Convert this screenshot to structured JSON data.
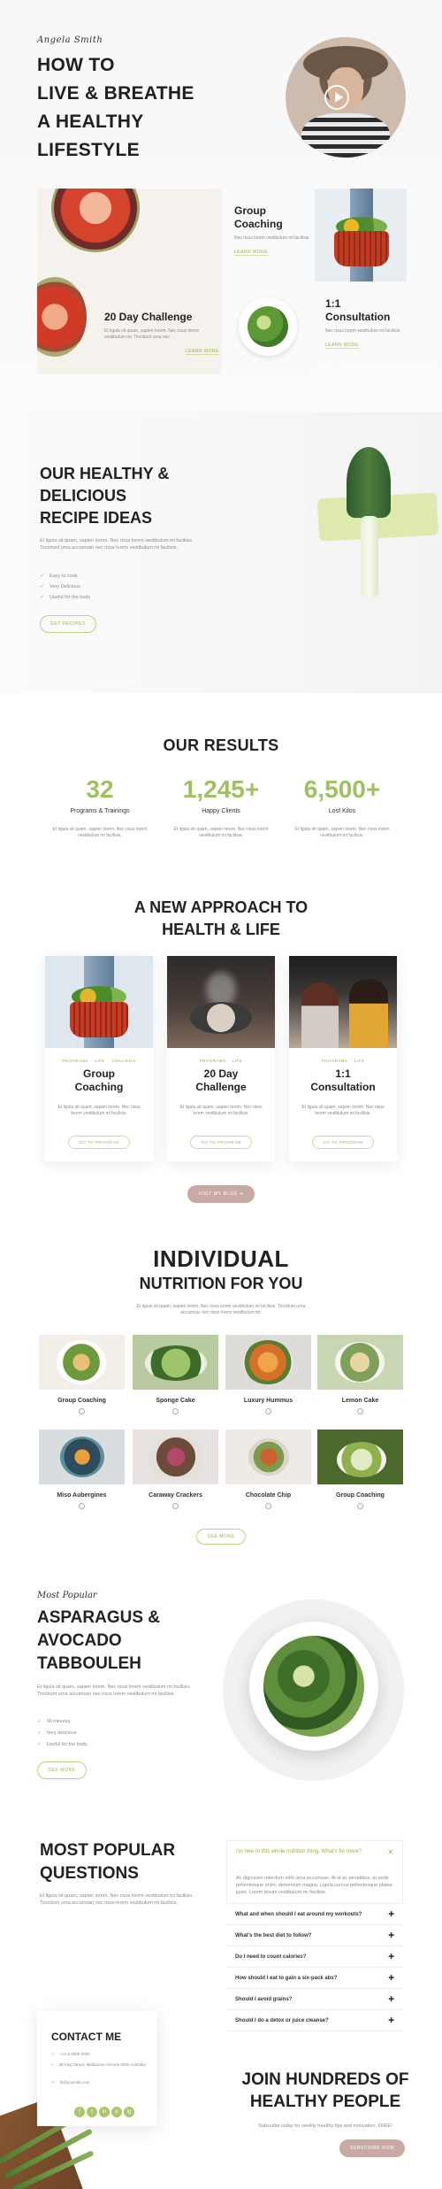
{
  "hero": {
    "signature": "Angela Smith",
    "title_lines": [
      "HOW TO",
      "LIVE & BREATHE",
      "A HEALTHY",
      "LIFESTYLE"
    ]
  },
  "services": {
    "challenge": {
      "title": "20 Day Challenge",
      "text": "Et ligula sit quam, sapien lorem. Nec risus lorem vestibulum mi. Tincidunt uma nec.",
      "link": "LEARN MORE"
    },
    "group": {
      "title_lines": [
        "Group",
        "Coaching"
      ],
      "text": "Nec risus lorem vestibulum mi facilisis.",
      "link": "LEARN MORE"
    },
    "consultation": {
      "title_lines": [
        "1:1",
        "Consultation"
      ],
      "text": "Nec risus lorem vestibulum mi facilisis.",
      "link": "LEARN MORE"
    }
  },
  "recipes": {
    "title_lines": [
      "OUR HEALTHY &",
      "DELICIOUS",
      "RECIPE IDEAS"
    ],
    "text": "Et ligula sit quam, sapien lorem. Nec risus lorem vestibulum mi facilisis. Tincidunt urna accumsan nec risus lorem vestibulum mi facilisis.",
    "list": [
      "Easy to cook",
      "Very Delicious",
      "Useful for the body"
    ],
    "button": "GET RECIPES",
    "check_icon": "check-icon"
  },
  "results": {
    "title": "OUR RESULTS",
    "stats": [
      {
        "number": "32",
        "label": "Programs & Trainings",
        "text": "Et ligula sit quam, sapien lorem. Nec risus lorem vestibulum mi facilisis."
      },
      {
        "number": "1,245+",
        "label": "Happy Clients",
        "text": "Et ligula sit quam, sapien lorem. Nec risus lorem vestibulum mi facilisis."
      },
      {
        "number": "6,500+",
        "label": "Lost Kilos",
        "text": "Et ligula sit quam, sapien lorem. Nec risus lorem vestibulum mi facilisis."
      }
    ]
  },
  "approach": {
    "title_lines": [
      "A NEW APPROACH TO",
      "HEALTH & LIFE"
    ],
    "cards": [
      {
        "tags": [
          "PROGRAMS",
          "LIFE",
          "COACHING"
        ],
        "title_lines": [
          "Group",
          "Coaching"
        ],
        "text": "Et ligula sit quam, sapien lorem. Nec risus lorem vestibulum mi facilisis.",
        "button": "GO TO PROGRAM"
      },
      {
        "tags": [
          "PROGRAMS",
          "LIFE"
        ],
        "title_lines": [
          "20 Day",
          "Challenge"
        ],
        "text": "Et ligula sit quam, sapien lorem. Nec risus lorem vestibulum mi facilisis.",
        "button": "GO TO PROGRAM"
      },
      {
        "tags": [
          "PROGRAMS",
          "LIFE"
        ],
        "title_lines": [
          "1:1",
          "Consultation"
        ],
        "text": "Et ligula sit quam, sapien lorem. Nec risus lorem vestibulum mi facilisis.",
        "button": "GO TO PROGRAM"
      }
    ],
    "visit_button": "VISIT MY BLOG ➔"
  },
  "nutrition": {
    "title1": "INDIVIDUAL",
    "title2": "NUTRITION FOR YOU",
    "text": "Et ligula sit quam, sapien lorem. Nec risus lorem vestibulum mi facilisis. Tincidunt urna accumsan nec risus lorem vestibulum mi.",
    "items": [
      "Group Coaching",
      "Sponge Cake",
      "Luxury Hummus",
      "Lemon Cake",
      "Miso Aubergines",
      "Caraway Crackers",
      "Chocolate Chip",
      "Group Coaching"
    ],
    "button": "SEE MORE"
  },
  "popular": {
    "signature": "Most Popular",
    "title_lines": [
      "ASPARAGUS &",
      "AVOCADO",
      "TABBOULEH"
    ],
    "text": "Et ligula sit quam, sapien lorem. Nec risus lorem vestibulum mi facilisis. Tincidunt urna accumsan nec risus lorem vestibulum mi facilisis.",
    "list": [
      "30 minutes",
      "Very delicious",
      "Useful for the body"
    ],
    "button": "SEE MORE"
  },
  "faq": {
    "title_lines": [
      "MOST POPULAR",
      "QUESTIONS"
    ],
    "text": "Et ligula sit quam, sapien lorem. Nec risus lorem vestibulum mi facilisis. Tincidunt urna accumsan nec risus lorem vestibulum mi facilisis.",
    "open_question": "I'm new to this whole nutrition thing. What's for more?",
    "open_answer": "Ac dignissim interdum nibh urna accumsan. At id ac penatibus, at pede pellentesque enim, dementum magna. Ligula cursus pellentesque platea justo. Lorem ipsum vestibulum mi facilisis.",
    "questions": [
      "What and when should I eat around my workouts?",
      "What's the best diet to follow?",
      "Do I need to count calories?",
      "How should I eat to gain a six-pack abs?",
      "Should I avoid grains?",
      "Should I do a detox or juice cleanse?"
    ]
  },
  "contact": {
    "title": "CONTACT ME",
    "phone": "+41 6 8808 0000",
    "address": "38 King Street, Melbourne Victoria 3000 Australia",
    "email": "hi@yoursite.com",
    "socials": [
      "f",
      "t",
      "in",
      "p",
      "ig"
    ]
  },
  "join": {
    "title_lines": [
      "JOIN HUNDREDS OF",
      "HEALTHY PEOPLE"
    ],
    "text": "Subscribe today for weekly healthy tips and motivation, FREE!",
    "button": "SUBSCRIBE NOW"
  },
  "colors": {
    "accent_green": "#9fc160",
    "rose_button": "#c9a9a4",
    "heading": "#222222"
  }
}
